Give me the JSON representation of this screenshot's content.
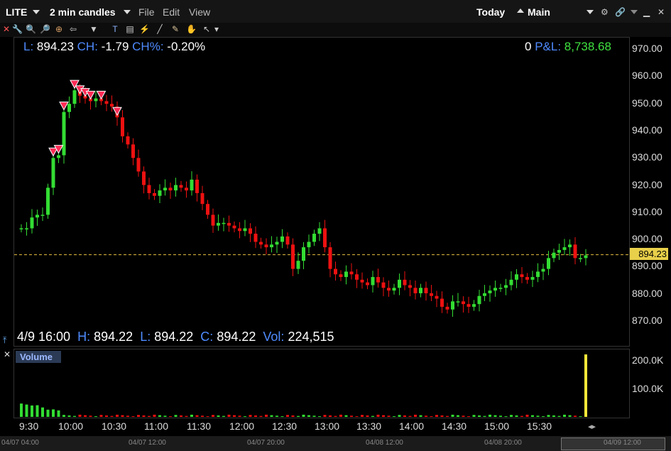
{
  "titlebar": {
    "symbol": "LITE",
    "interval": "2 min candles",
    "menus": [
      "File",
      "Edit",
      "View"
    ],
    "range": "Today",
    "layout": "Main"
  },
  "header": {
    "last_label": "L:",
    "last_value": "894.23",
    "change_label": "CH:",
    "change_value": "-1.79",
    "change_pct_label": "CH%:",
    "change_pct_value": "-0.20%",
    "position": "0",
    "pnl_label": "P&L:",
    "pnl_value": "8,738.68"
  },
  "ohlc": {
    "datetime": "4/9 16:00",
    "h_label": "H:",
    "h_value": "894.22",
    "l_label": "L:",
    "l_value": "894.22",
    "c_label": "C:",
    "c_value": "894.22",
    "vol_label": "Vol:",
    "vol_value": "224,515"
  },
  "price_tag": "894.23",
  "volume_pane_label": "Volume",
  "price_axis": [
    "970.00",
    "960.00",
    "950.00",
    "940.00",
    "930.00",
    "920.00",
    "910.00",
    "900.00",
    "890.00",
    "880.00",
    "870.00"
  ],
  "volume_axis": [
    "200.0K",
    "100.0K"
  ],
  "time_axis": [
    "9:30",
    "10:00",
    "10:30",
    "11:00",
    "11:30",
    "12:00",
    "12:30",
    "13:00",
    "13:30",
    "14:00",
    "14:30",
    "15:00",
    "15:30"
  ],
  "date_axis": [
    "04/07 04:00",
    "04/07 12:00",
    "04/07 20:00",
    "04/08 12:00",
    "04/08 20:00",
    "04/09 12:00"
  ],
  "colors": {
    "up": "#33dd33",
    "down": "#ee1111",
    "last_line": "#e8c040",
    "background": "#000000"
  },
  "chart_data": {
    "type": "candlestick",
    "ylim": [
      866,
      974
    ],
    "last_price": 894.23,
    "candles_close": [
      904,
      904,
      908,
      909,
      909,
      919,
      930,
      931,
      947,
      950,
      955,
      953,
      952,
      951,
      952,
      951,
      950,
      949,
      945,
      938,
      935,
      930,
      925,
      920,
      917,
      916,
      918,
      919,
      918,
      920,
      919,
      918,
      922,
      917,
      913,
      909,
      905,
      906,
      906,
      905,
      904,
      903,
      904,
      902,
      899,
      898,
      897,
      898,
      899,
      901,
      898,
      889,
      892,
      897,
      899,
      902,
      904,
      897,
      889,
      887,
      886,
      888,
      887,
      885,
      884,
      883,
      886,
      884,
      882,
      881,
      882,
      885,
      883,
      882,
      880,
      882,
      880,
      879,
      878,
      875,
      874,
      877,
      877,
      876,
      875,
      876,
      879,
      880,
      881,
      882,
      882,
      883,
      885,
      887,
      886,
      885,
      886,
      888,
      889,
      893,
      895,
      896,
      897,
      898,
      893,
      893,
      894
    ],
    "volume": {
      "max_shown": 224515,
      "last_bar": 224515
    }
  }
}
